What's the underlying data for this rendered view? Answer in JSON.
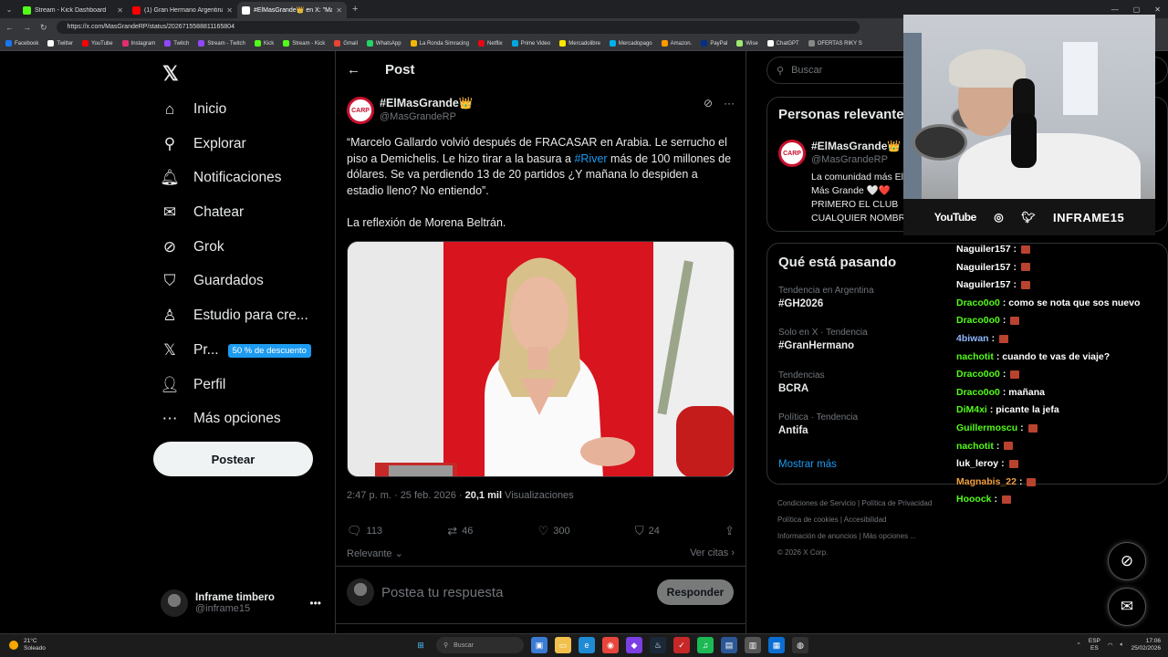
{
  "browser": {
    "tabs": [
      {
        "title": "Stream - Kick Dashboard",
        "icon": "kick-icon",
        "color": "#53fc18"
      },
      {
        "title": "(1) Gran Hermano Argentina - You",
        "icon": "youtube-icon",
        "color": "#ff0000"
      },
      {
        "title": "#ElMasGrande👑 en X: \"Marcelo",
        "icon": "x-icon",
        "color": "#ffffff"
      }
    ],
    "url": "https://x.com/MasGrandeRP/status/2026715588811165804",
    "bookmarks": [
      {
        "label": "Facebook",
        "color": "#1877f2"
      },
      {
        "label": "Twitter",
        "color": "#ffffff"
      },
      {
        "label": "YouTube",
        "color": "#ff0000"
      },
      {
        "label": "Instagram",
        "color": "#e1306c"
      },
      {
        "label": "Twitch",
        "color": "#9146ff"
      },
      {
        "label": "Stream - Twitch",
        "color": "#9146ff"
      },
      {
        "label": "Kick",
        "color": "#53fc18"
      },
      {
        "label": "Stream - Kick",
        "color": "#53fc18"
      },
      {
        "label": "Gmail",
        "color": "#ea4335"
      },
      {
        "label": "WhatsApp",
        "color": "#25d366"
      },
      {
        "label": "La Ronda Simracing",
        "color": "#f2b705"
      },
      {
        "label": "Netflix",
        "color": "#e50914"
      },
      {
        "label": "Prime Video",
        "color": "#00a8e1"
      },
      {
        "label": "Mercadolibre",
        "color": "#ffe600"
      },
      {
        "label": "Mercadopago",
        "color": "#00b1ea"
      },
      {
        "label": "Amazon.",
        "color": "#ff9900"
      },
      {
        "label": "PayPal",
        "color": "#003087"
      },
      {
        "label": "Wise",
        "color": "#9fe870"
      },
      {
        "label": "ChatGPT",
        "color": "#ffffff"
      },
      {
        "label": "OFERTAS RIKY S",
        "color": "#888888"
      }
    ]
  },
  "nav": {
    "items": [
      {
        "label": "Inicio",
        "icon": "home-icon",
        "glyph": "⌂"
      },
      {
        "label": "Explorar",
        "icon": "search-icon",
        "glyph": "⚲"
      },
      {
        "label": "Notificaciones",
        "icon": "bell-icon",
        "glyph": "🔔︎"
      },
      {
        "label": "Chatear",
        "icon": "mail-icon",
        "glyph": "✉"
      },
      {
        "label": "Grok",
        "icon": "grok-icon",
        "glyph": "⊘"
      },
      {
        "label": "Guardados",
        "icon": "bookmark-icon",
        "glyph": "⛉"
      },
      {
        "label": "Estudio para cre...",
        "icon": "studio-icon",
        "glyph": "♙"
      },
      {
        "label": "Pr...",
        "icon": "x-premium-icon",
        "glyph": "𝕏"
      },
      {
        "label": "Perfil",
        "icon": "person-icon",
        "glyph": "👤︎"
      },
      {
        "label": "Más opciones",
        "icon": "more-circle-icon",
        "glyph": "⋯"
      }
    ],
    "promo": "50 % de descuento",
    "post_button": "Postear",
    "account": {
      "name": "Inframe timbero",
      "handle": "@inframe15"
    }
  },
  "post": {
    "header": "Post",
    "author": {
      "name": "#ElMasGrande👑",
      "handle": "@MasGrandeRP"
    },
    "text_before": "“Marcelo Gallardo volvió después de FRACASAR en Arabia. Le serrucho el piso a Demichelis. Le hizo tirar a la basura a ",
    "hashtag": "#River",
    "text_after": " más de 100 millones de dólares. Se va perdiendo 13 de 20 partidos ¿Y mañana lo despiden a estadio lleno? No entiendo”.",
    "reflection": "La reflexión de Morena Beltrán.",
    "time": "2:47 p. m. · 25 feb. 2026 · ",
    "views_count": "20,1 mil",
    "views_label": " Visualizaciones",
    "stats": {
      "replies": "113",
      "reposts": "46",
      "likes": "300",
      "bookmarks": "24"
    },
    "sort_label": "Relevante",
    "quotes_label": "Ver citas",
    "reply_placeholder": "Postea tu respuesta",
    "reply_button": "Responder"
  },
  "sidebar": {
    "search_placeholder": "Buscar",
    "people_title": "Personas relevantes",
    "person": {
      "name": "#ElMasGrande👑",
      "handle": "@MasGrandeRP",
      "bio": "La comunidad más El Más Grande 🤍❤️ PRIMERO EL CLUB CUALQUIER NOMBR"
    },
    "trends_title": "Qué está pasando",
    "trends": [
      {
        "context": "Tendencia en Argentina",
        "topic": "#GH2026"
      },
      {
        "context": "Solo en X · Tendencia",
        "topic": "#GranHermano"
      },
      {
        "context": "Tendencias",
        "topic": "BCRA"
      },
      {
        "context": "Política · Tendencia",
        "topic": "Antifa"
      }
    ],
    "show_more": "Mostrar más",
    "footer": [
      "Condiciones de Servicio",
      "Política de Privacidad",
      "Política de cookies",
      "Accesibilidad",
      "Información de anuncios",
      "Más opciones ...",
      "© 2026 X Corp."
    ]
  },
  "stream_overlay": {
    "platform_label": "YouTube",
    "channel": "INFRAME15",
    "chat": [
      {
        "user": "Naguiler157",
        "color": "#ffffff",
        "text": "",
        "emote": true
      },
      {
        "user": "Naguiler157",
        "color": "#ffffff",
        "text": "",
        "emote": true
      },
      {
        "user": "Naguiler157",
        "color": "#ffffff",
        "text": "",
        "emote": true
      },
      {
        "user": "Draco0o0",
        "color": "#53fc18",
        "text": "como se nota que sos nuevo",
        "emote": false
      },
      {
        "user": "Draco0o0",
        "color": "#53fc18",
        "text": "",
        "emote": true
      },
      {
        "user": "4biwan",
        "color": "#8fb8ff",
        "text": "",
        "emote": true
      },
      {
        "user": "nachotit",
        "color": "#53fc18",
        "text": "cuando te vas de viaje?",
        "emote": false
      },
      {
        "user": "Draco0o0",
        "color": "#53fc18",
        "text": "",
        "emote": true
      },
      {
        "user": "Draco0o0",
        "color": "#53fc18",
        "text": "mañana",
        "emote": false
      },
      {
        "user": "DiM4xi",
        "color": "#53fc18",
        "text": "picante la jefa",
        "emote": false
      },
      {
        "user": "Guillermoscu",
        "color": "#53fc18",
        "text": "",
        "emote": true
      },
      {
        "user": "nachotit",
        "color": "#53fc18",
        "text": "",
        "emote": true
      },
      {
        "user": "luk_leroy",
        "color": "#ffffff",
        "text": "",
        "emote": true
      },
      {
        "user": "Magnabis_22",
        "color": "#f0a040",
        "text": "",
        "emote": true
      },
      {
        "user": "Hooock",
        "color": "#53fc18",
        "text": "",
        "emote": true
      }
    ]
  },
  "taskbar": {
    "weather_temp": "21°C",
    "weather_desc": "Soleado",
    "search": "Buscar",
    "lang_1": "ESP",
    "lang_2": "ES",
    "time": "17:06",
    "date": "25/02/2026"
  }
}
